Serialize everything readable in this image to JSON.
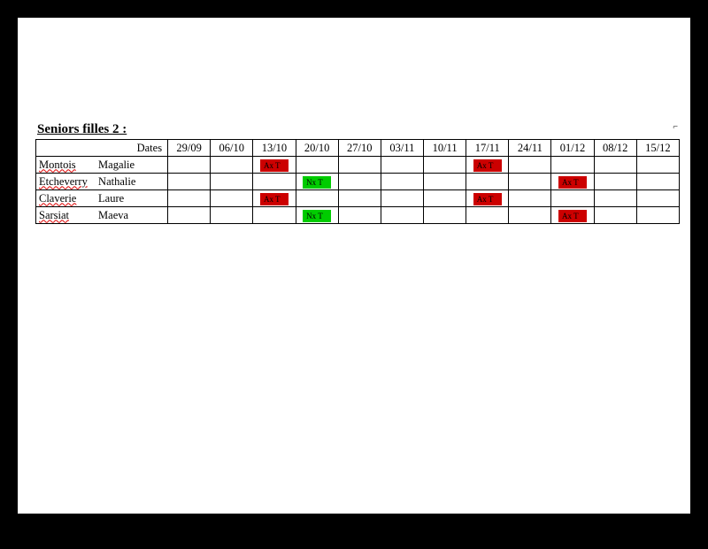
{
  "title": "Seniors filles 2 :",
  "dates_label": "Dates",
  "dates": [
    "29/09",
    "06/10",
    "13/10",
    "20/10",
    "27/10",
    "03/11",
    "10/11",
    "17/11",
    "24/11",
    "01/12",
    "08/12",
    "15/12"
  ],
  "colors": {
    "red": "#cc0000",
    "green": "#00cc00"
  },
  "legend_codes": {
    "Ax_T": "Ax  T",
    "Nx_T": "Nx  T"
  },
  "rows": [
    {
      "last": "Montois",
      "first": "Magalie",
      "last_squiggle": true,
      "cells": [
        "",
        "",
        {
          "text": "Ax  T",
          "color": "red"
        },
        "",
        "",
        "",
        "",
        {
          "text": "Ax T",
          "color": "red"
        },
        "",
        "",
        "",
        ""
      ]
    },
    {
      "last": "Etcheverry",
      "first": "Nathalie",
      "last_squiggle": true,
      "cells": [
        "",
        "",
        "",
        {
          "text": "Nx  T",
          "color": "green"
        },
        "",
        "",
        "",
        "",
        "",
        {
          "text": "Ax T",
          "color": "red"
        },
        "",
        ""
      ]
    },
    {
      "last": "Claverie",
      "first": "Laure",
      "last_squiggle": true,
      "cells": [
        "",
        "",
        {
          "text": "Ax  T",
          "color": "red"
        },
        "",
        "",
        "",
        "",
        {
          "text": "Ax T",
          "color": "red"
        },
        "",
        "",
        "",
        ""
      ]
    },
    {
      "last": "Sarsiat",
      "first": "Maeva",
      "last_squiggle": true,
      "cells": [
        "",
        "",
        "",
        {
          "text": "Nx  T",
          "color": "green"
        },
        "",
        "",
        "",
        "",
        "",
        {
          "text": "Ax T",
          "color": "red"
        },
        "",
        ""
      ]
    }
  ],
  "endmark": "⌐"
}
